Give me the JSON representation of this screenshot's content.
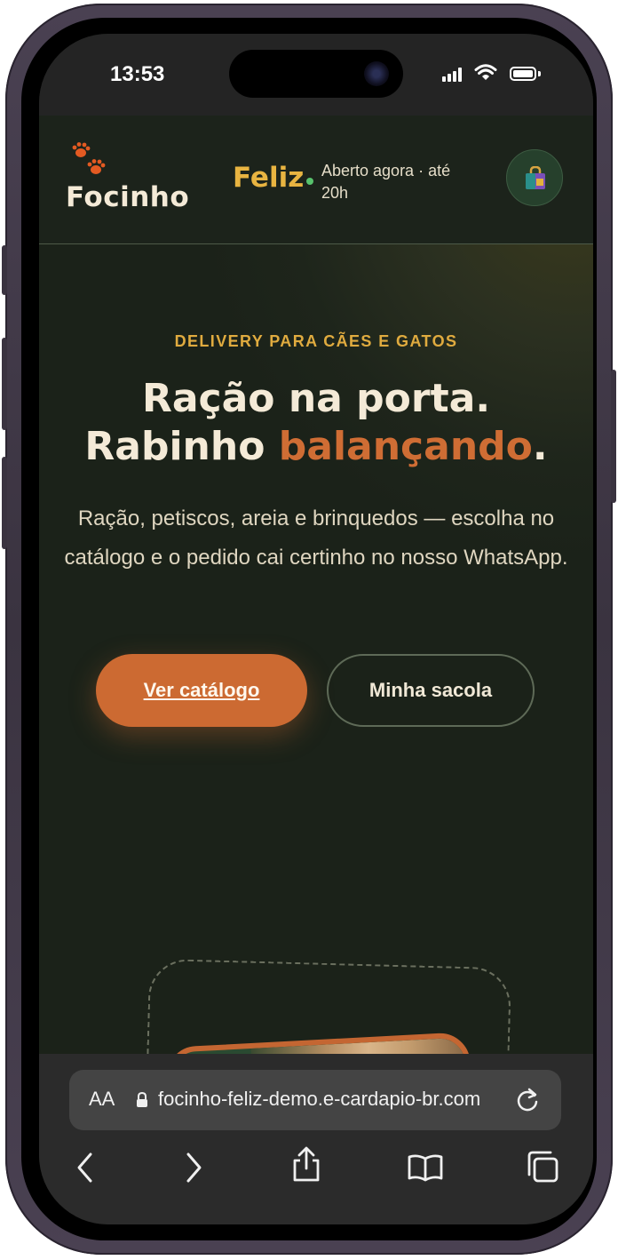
{
  "status_bar": {
    "time": "13:53"
  },
  "header": {
    "logo_word_1": "Focinho",
    "logo_word_2": "Feliz",
    "open_status": "Aberto agora · até 20h",
    "bag_button_icon": "shopping-bag-icon"
  },
  "hero": {
    "eyebrow": "DELIVERY PARA CÃES E GATOS",
    "headline_line1": "Ração na porta.",
    "headline_line2_pre": "Rabinho ",
    "headline_line2_accent": "balançando",
    "headline_line2_post": ".",
    "lead": "Ração, petiscos, areia e brinquedos — escolha no catálogo e o pedido cai certinho no nosso WhatsApp.",
    "primary_cta": "Ver catálogo",
    "secondary_cta": "Minha sacola"
  },
  "browser": {
    "text_size_label": "AA",
    "url": "focinho-feliz-demo.e-cardapio-br.com"
  },
  "colors": {
    "accent_orange": "#cc6a32",
    "accent_gold": "#e0ab3f",
    "background_dark_green": "#1d241b",
    "cream_text": "#f4ead7",
    "open_dot_green": "#58c26d"
  }
}
